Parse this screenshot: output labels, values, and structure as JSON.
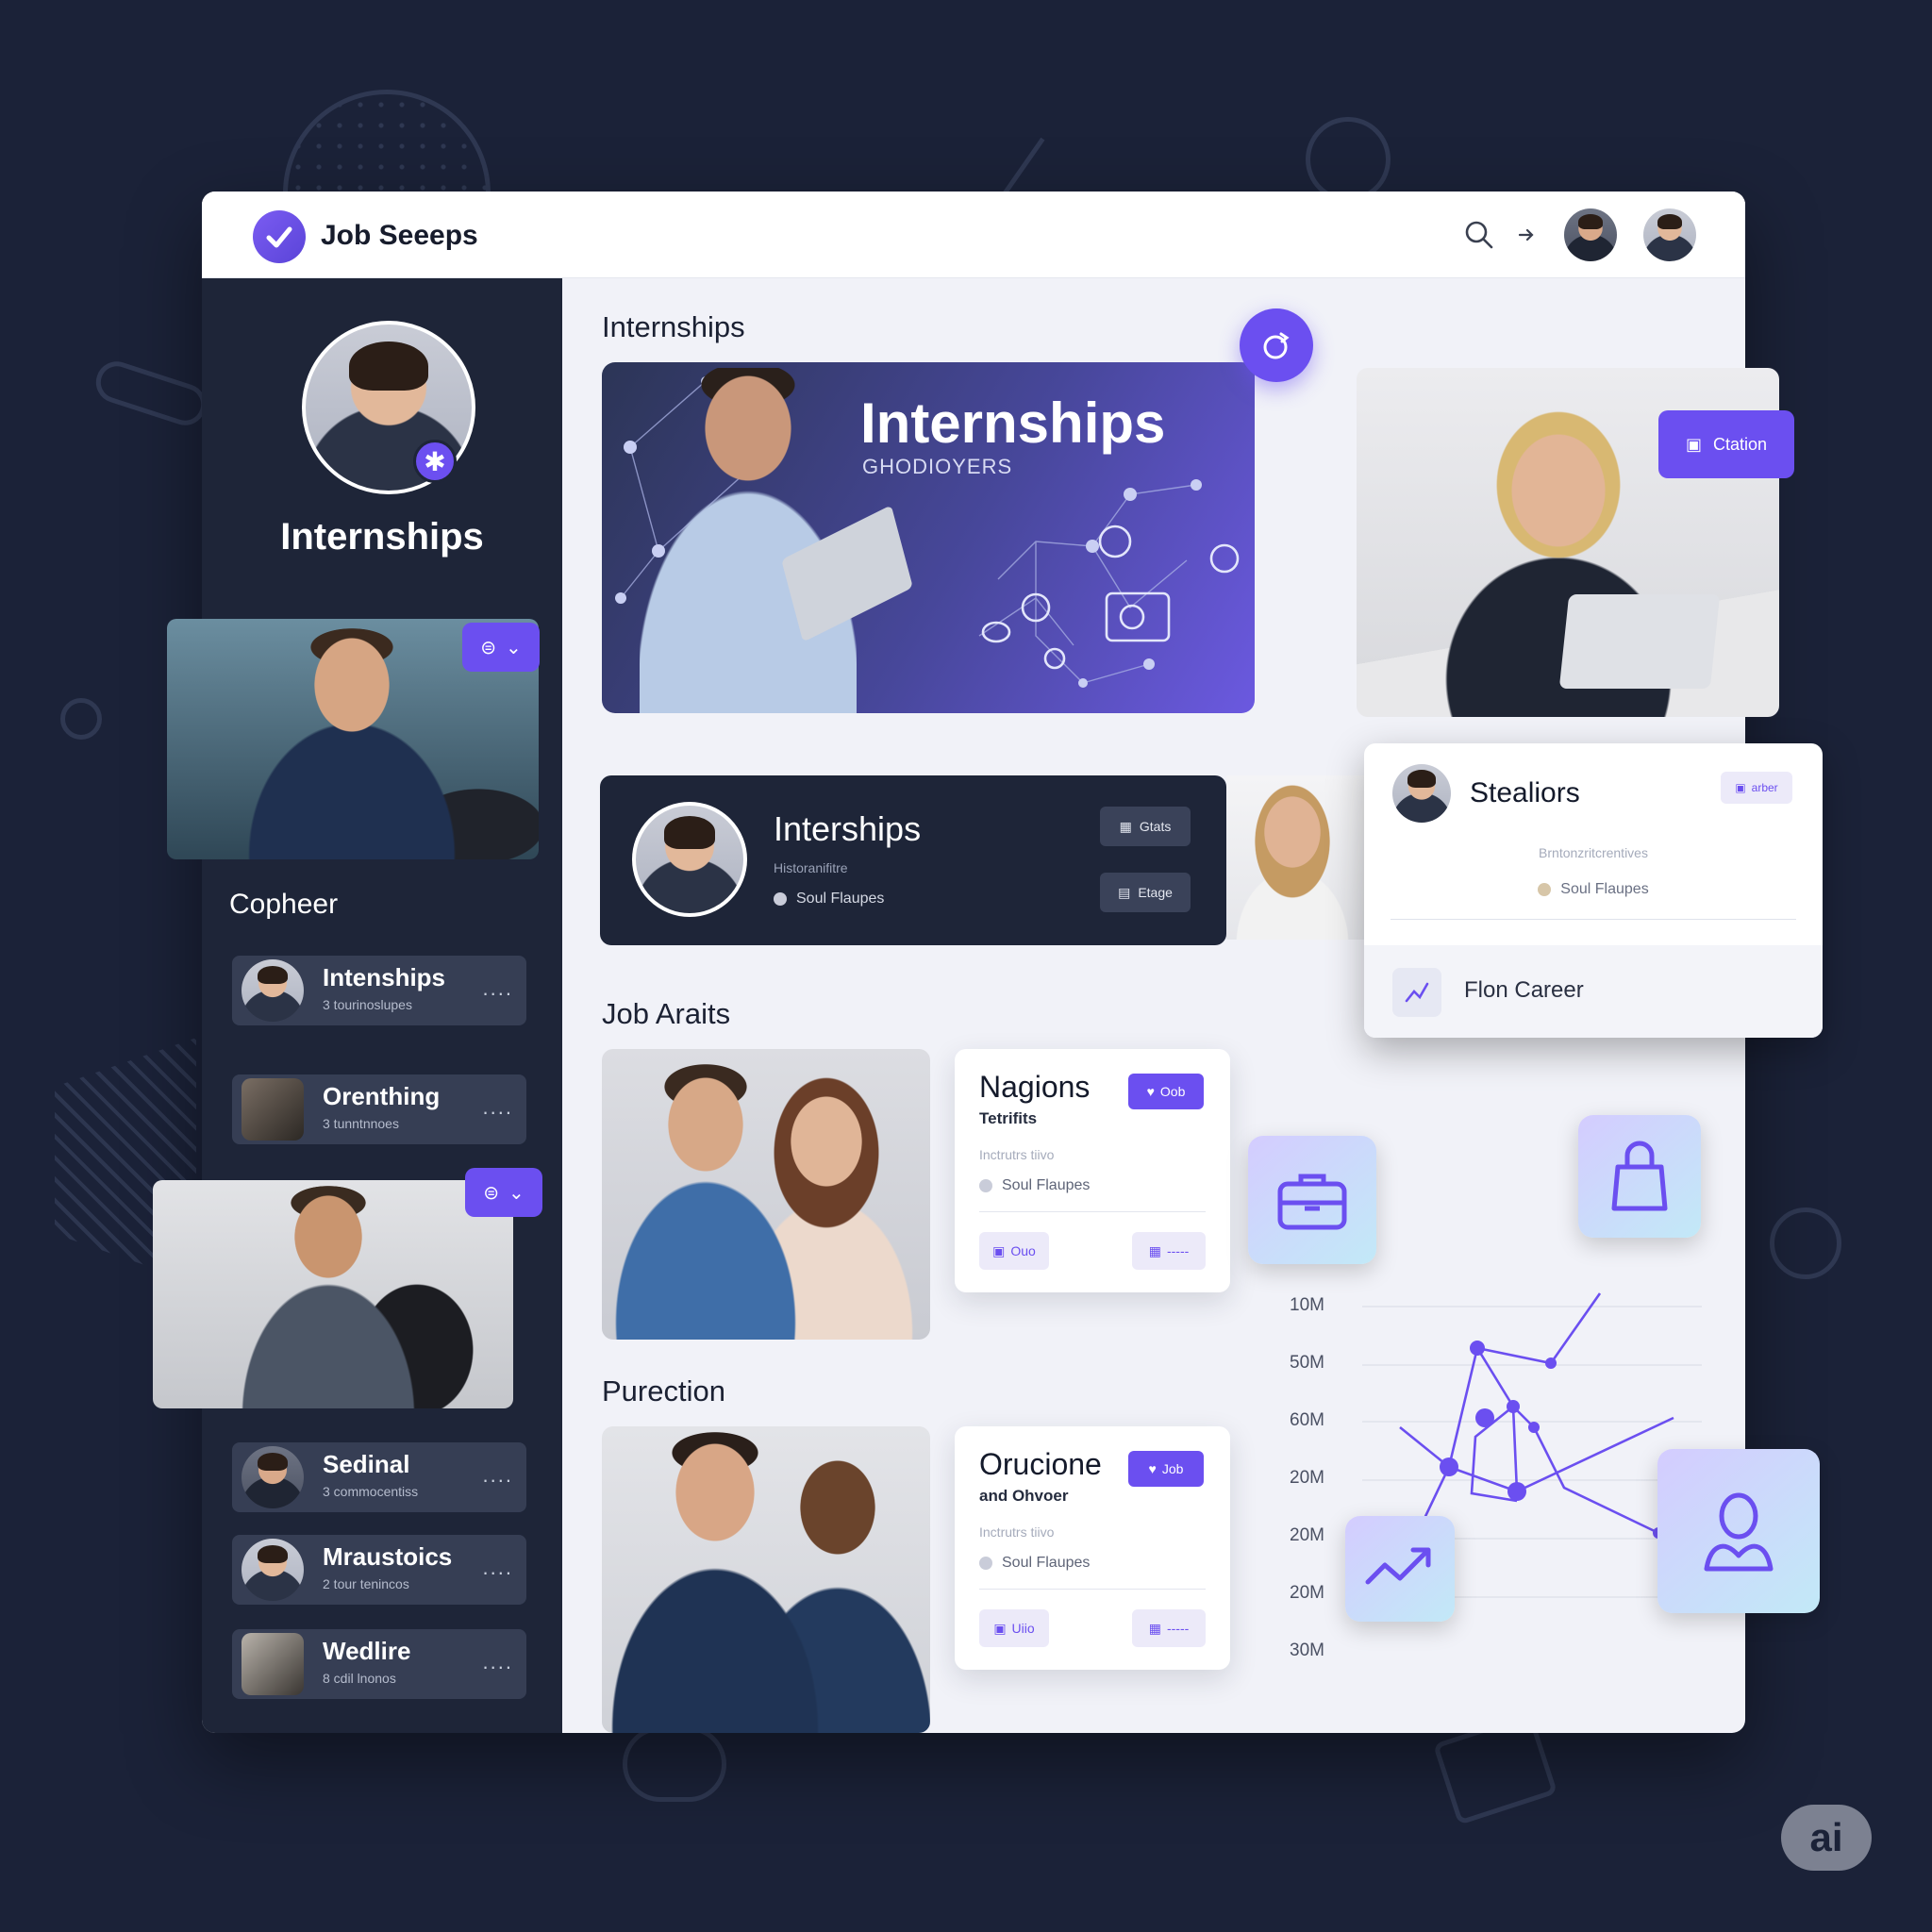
{
  "app": {
    "title": "Job Seeeps"
  },
  "header": {
    "search_icon": "search-icon",
    "arrow_icon": "arrow-right-icon"
  },
  "sidebar": {
    "profile_title": "Internships",
    "photo_tags": [
      "",
      ""
    ],
    "section_label": "Copheer",
    "items": [
      {
        "label": "Intenships",
        "sub": "3 tourinoslupes"
      },
      {
        "label": "Orenthing",
        "sub": "3 tunntnnoes"
      },
      {
        "label": "Sedinal",
        "sub": "3 commocentiss"
      },
      {
        "label": "Mraustoics",
        "sub": "2 tour tenincos"
      },
      {
        "label": "Wedlire",
        "sub": "8 cdil lnonos"
      }
    ],
    "more_glyph": "...."
  },
  "main": {
    "heading_1": "Internships",
    "hero": {
      "title": "Internships",
      "subtitle": "GHODIOYERS"
    },
    "dark_card": {
      "title": "Interships",
      "sub": "Historanifitre",
      "meta": "Soul Flaupes",
      "btn1": "Gtats",
      "btn2": "Etage"
    },
    "heading_2": "Job Araits",
    "card_1": {
      "title": "Nagions",
      "sub": "Tetrifits",
      "faint": "Inctrutrs tiivo",
      "meta": "Soul Flaupes",
      "pill": "Oob",
      "btn_left": "Ouo",
      "btn_right": "-----"
    },
    "heading_3": "Purection",
    "card_2": {
      "title": "Orucione",
      "sub": "and Ohvoer",
      "faint": "Inctrutrs tiivo",
      "meta": "Soul Flaupes",
      "pill": "Job",
      "btn_left": "Uiio",
      "btn_right": "-----"
    }
  },
  "right": {
    "chat_bubble": "Ctation",
    "profile_card": {
      "name": "Stealiors",
      "tag": "arber",
      "faint": "Brntonzritcrentives",
      "meta": "Soul Flaupes",
      "footer_label": "Flon Career"
    },
    "axis_labels": [
      "10M",
      "50M",
      "60M",
      "20M",
      "20M",
      "20M",
      "30M"
    ]
  },
  "badge": "ai",
  "colors": {
    "accent": "#6b4ff0",
    "dark": "#1e2538",
    "page_bg": "#1b2238"
  }
}
